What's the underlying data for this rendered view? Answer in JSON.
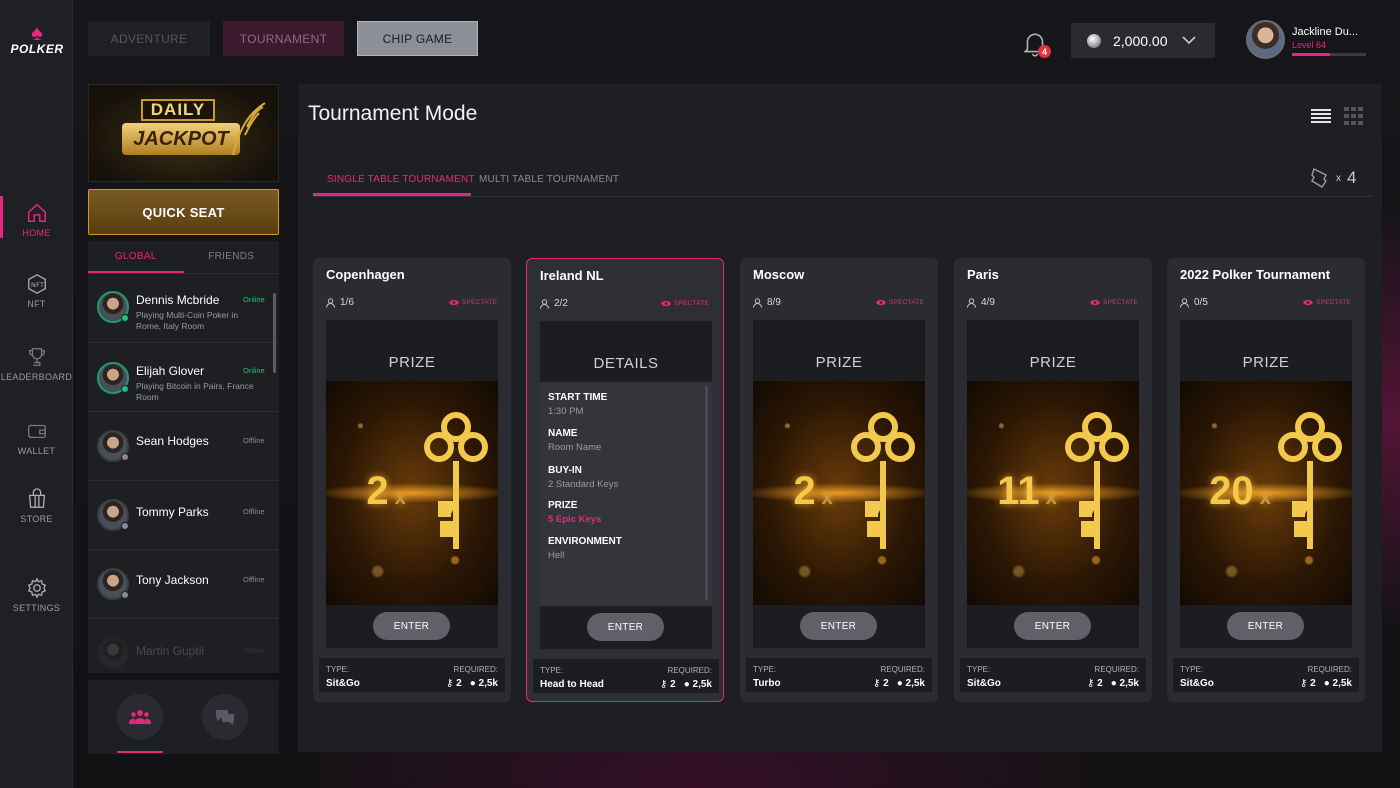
{
  "brand": {
    "name": "POLKER"
  },
  "nav": [
    {
      "label": "HOME",
      "icon": "home-icon"
    },
    {
      "label": "NFT",
      "icon": "nft-icon"
    },
    {
      "label": "LEADERBOARD",
      "icon": "trophy-icon"
    },
    {
      "label": "WALLET",
      "icon": "wallet-icon"
    },
    {
      "label": "STORE",
      "icon": "store-icon"
    },
    {
      "label": "SETTINGS",
      "icon": "gear-icon"
    }
  ],
  "topbar": {
    "modes": [
      "ADVENTURE",
      "TOURNAMENT",
      "CHIP GAME"
    ],
    "notifications": "4",
    "balance": "2,000.00",
    "user_name": "Jackline Du...",
    "user_level": "Level  64",
    "level_progress": 0.52
  },
  "jackpot": {
    "daily": "DAILY",
    "jackpot": "JACKPOT"
  },
  "quick_seat": "QUICK SEAT",
  "friends": {
    "tabs": [
      "GLOBAL",
      "FRIENDS"
    ],
    "list": [
      {
        "name": "Dennis Mcbride",
        "status": "Online",
        "desc": "Playing Multi-Coin Poker in Rome, Italy Room"
      },
      {
        "name": "Elijah Glover",
        "status": "Online",
        "desc": "Playing Bitcoin in Pairs, France Room"
      },
      {
        "name": "Sean Hodges",
        "status": "Offline",
        "desc": ""
      },
      {
        "name": "Tommy Parks",
        "status": "Offline",
        "desc": ""
      },
      {
        "name": "Tony Jackson",
        "status": "Offline",
        "desc": ""
      },
      {
        "name": "Martin Guptil",
        "status": "Offline",
        "desc": ""
      }
    ]
  },
  "main": {
    "title": "Tournament Mode",
    "tabs": [
      "SINGLE TABLE TOURNAMENT",
      "MULTI TABLE TOURNAMENT"
    ],
    "tickets_x": "x",
    "tickets_count": "4",
    "spectate": "SPECTATE",
    "prize_heading": "PRIZE",
    "details_heading": "DETAILS",
    "enter": "ENTER",
    "type_label": "TYPE:",
    "required_label": "REQUIRED:",
    "cards": [
      {
        "title": "Copenhagen",
        "players": "1/6",
        "multiplier": "2",
        "type": "Sit&Go",
        "keys": "2",
        "chips": "2,5k"
      },
      {
        "title": "Ireland NL",
        "players": "2/2",
        "multiplier": "",
        "type": "Head to Head",
        "keys": "2",
        "chips": "2,5k"
      },
      {
        "title": "Moscow",
        "players": "8/9",
        "multiplier": "2",
        "type": "Turbo",
        "keys": "2",
        "chips": "2,5k"
      },
      {
        "title": "Paris",
        "players": "4/9",
        "multiplier": "11",
        "type": "Sit&Go",
        "keys": "2",
        "chips": "2,5k"
      },
      {
        "title": "2022 Polker Tournament",
        "players": "0/5",
        "multiplier": "20",
        "type": "Sit&Go",
        "keys": "2",
        "chips": "2,5k"
      }
    ],
    "details": {
      "start_time_label": "START TIME",
      "start_time": "1:30 PM",
      "name_label": "NAME",
      "name": "Room Name",
      "buyin_label": "BUY-IN",
      "buyin": "2 Standard Keys",
      "prize_label": "PRIZE",
      "prize": "5 Epic Keys",
      "env_label": "ENVIRONMENT",
      "env": "Hell"
    },
    "multiplier_x": "x"
  },
  "colors": {
    "accent": "#e5287f",
    "gold": "#c9992f",
    "online": "#22c07a",
    "panel": "#1e1f23",
    "card": "#2b2c31"
  }
}
